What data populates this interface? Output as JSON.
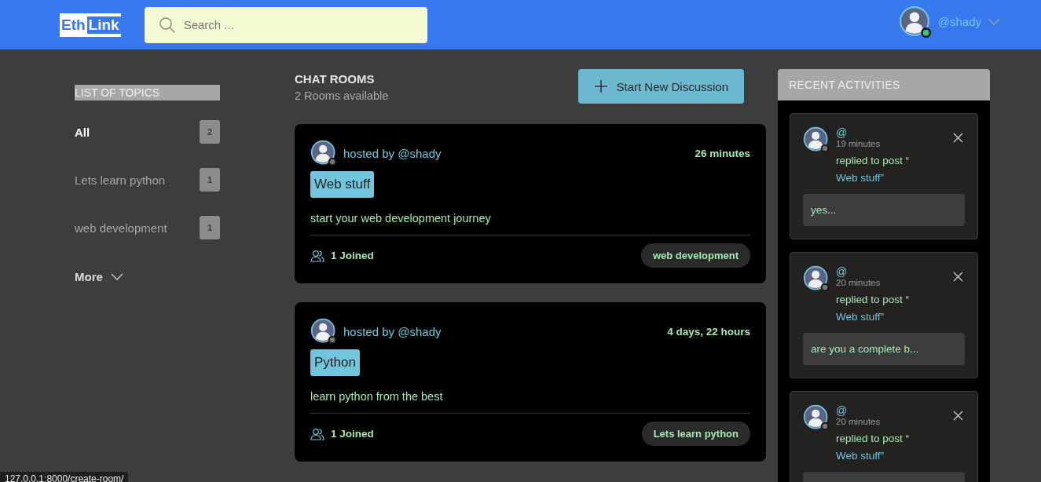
{
  "header": {
    "logo": [
      "Eth",
      "Link"
    ],
    "search": {
      "placeholder": "Search ..."
    },
    "user": {
      "name": "@shady",
      "online": true
    }
  },
  "topics": {
    "title": "LIST OF TOPICS",
    "items": [
      {
        "label": "All",
        "count": "2",
        "selected": true
      },
      {
        "label": "Lets learn python",
        "count": "1",
        "selected": false
      },
      {
        "label": "web development",
        "count": "1",
        "selected": false
      }
    ],
    "more": "More"
  },
  "rooms": {
    "title": "CHAT ROOMS",
    "subtitle": "2 Rooms available",
    "new_button": "Start New Discussion",
    "items": [
      {
        "host": "hosted by @shady",
        "host_online": false,
        "time": "26 minutes",
        "name": "Web stuff",
        "description": "start your web development journey",
        "joined": "1 Joined",
        "topic": "web development"
      },
      {
        "host": "hosted by @shady",
        "host_online": false,
        "time": "4 days, 22 hours",
        "name": "Python",
        "description": "learn python from the best",
        "joined": "1 Joined",
        "topic": "Lets learn python"
      }
    ]
  },
  "activities": {
    "title": "RECENT ACTIVITIES",
    "items": [
      {
        "user": "@",
        "online": false,
        "time": "19 minutes",
        "action": "replied to post “",
        "post": "Web stuff”",
        "message": "yes..."
      },
      {
        "user": "@",
        "online": false,
        "time": "20 minutes",
        "action": "replied to post “",
        "post": "Web stuff”",
        "message": "are you a complete b..."
      },
      {
        "user": "@",
        "online": false,
        "time": "20 minutes",
        "action": "replied to post “",
        "post": "Web stuff”"
      }
    ]
  },
  "status_bar": {
    "url": "127.0.0.1:8000/create-room/"
  }
}
